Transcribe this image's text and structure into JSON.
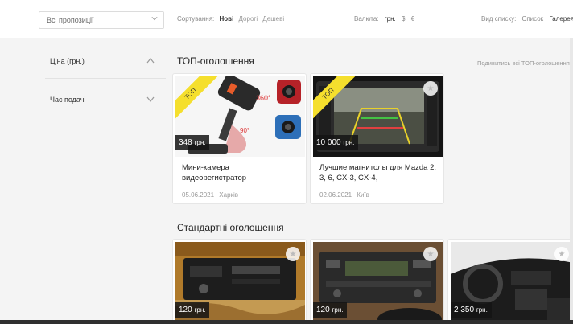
{
  "filters": {
    "proposal_select": "Всі пропозиції",
    "sort_label": "Сортування:",
    "sort_options": [
      "Нові",
      "Дорогі",
      "Дешеві"
    ],
    "currency_label": "Валюта:",
    "currency_options": [
      "грн.",
      "$",
      "€"
    ],
    "view_label": "Вид списку:",
    "view_options": [
      "Список",
      "Галерея"
    ]
  },
  "sidebar": {
    "items": [
      {
        "label": "Ціна (грн.)",
        "state": "expanded"
      },
      {
        "label": "Час подачі",
        "state": "collapsed"
      }
    ]
  },
  "top_section": {
    "title": "ТОП-оголошення",
    "see_all": "Подивитись всі ТОП-оголошення",
    "badge": "ТОП",
    "cards": [
      {
        "price": "348",
        "currency": "грн.",
        "title": "Мини-камера видеорегистратор",
        "date": "05.06.2021",
        "city": "Харків",
        "image": "mini-camera-photo"
      },
      {
        "price": "10 000",
        "currency": "грн.",
        "title": "Лучшие магнитолы для Mazda 2, 3, 6, CX-3, CX-4,",
        "date": "02.06.2021",
        "city": "Київ",
        "image": "car-stereo-screen-photo"
      }
    ]
  },
  "standard_section": {
    "title": "Стандартні оголошення",
    "cards": [
      {
        "price": "120",
        "currency": "грн.",
        "image": "cassette-radio-photo"
      },
      {
        "price": "120",
        "currency": "грн.",
        "image": "car-radio-photo"
      },
      {
        "price": "2 350",
        "currency": "грн.",
        "image": "car-interior-photo"
      }
    ]
  },
  "colors": {
    "ribbon": "#f5df2d",
    "price_bg": "#1a1a1a",
    "accent_text": "#333333"
  }
}
